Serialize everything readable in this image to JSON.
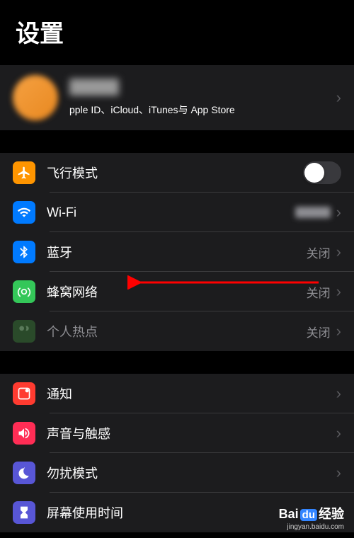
{
  "header": {
    "title": "设置"
  },
  "profile": {
    "subtitle": "pple ID、iCloud、iTunes与 App Store"
  },
  "group1": {
    "airplane": "飞行模式",
    "wifi": "Wi-Fi",
    "bluetooth": "蓝牙",
    "bluetooth_value": "关闭",
    "cellular": "蜂窝网络",
    "cellular_value": "关闭",
    "hotspot": "个人热点",
    "hotspot_value": "关闭"
  },
  "group2": {
    "notifications": "通知",
    "sounds": "声音与触感",
    "dnd": "勿扰模式",
    "screentime": "屏幕使用时间"
  },
  "watermark": {
    "brand_prefix": "Bai",
    "brand_mid": "du",
    "brand_suffix": "经验",
    "url": "jingyan.baidu.com"
  }
}
